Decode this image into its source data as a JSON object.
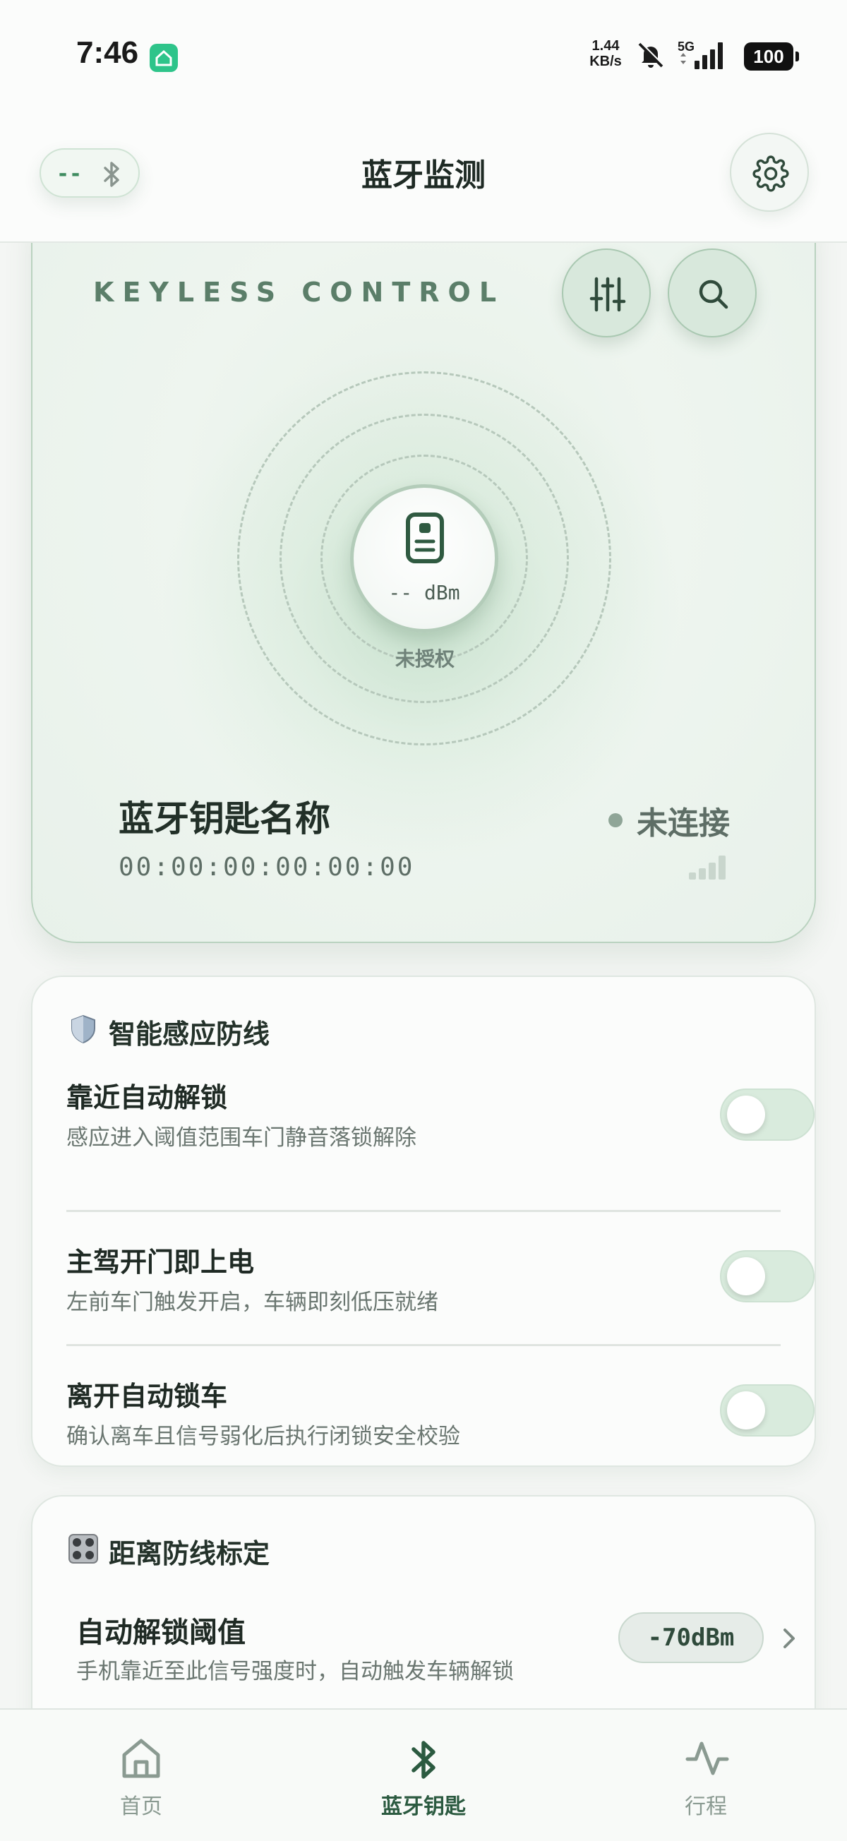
{
  "status_bar": {
    "time": "7:46",
    "net_speed_value": "1.44",
    "net_speed_unit": "KB/s",
    "network": "5G",
    "battery": "100"
  },
  "app_bar": {
    "title": "蓝牙监测",
    "bt_chip_text": "--"
  },
  "hero": {
    "heading": "KEYLESS CONTROL",
    "rssi": "-- dBm",
    "auth_status": "未授权",
    "device_name": "蓝牙钥匙名称",
    "device_mac": "00:00:00:00:00:00",
    "connection_status": "未连接"
  },
  "defense": {
    "title_icon": "🛡️",
    "title": "智能感应防线",
    "items": [
      {
        "title": "靠近自动解锁",
        "desc": "感应进入阈值范围车门静音落锁解除",
        "enabled": false
      },
      {
        "title": "主驾开门即上电",
        "desc": "左前车门触发开启，车辆即刻低压就绪",
        "enabled": false
      },
      {
        "title": "离开自动锁车",
        "desc": "确认离车且信号弱化后执行闭锁安全校验",
        "enabled": false
      }
    ]
  },
  "distance": {
    "title_icon": "🎛️",
    "title": "距离防线标定",
    "threshold_title": "自动解锁阈值",
    "threshold_desc": "手机靠近至此信号强度时，自动触发车辆解锁",
    "threshold_value": "-70dBm"
  },
  "bottom_nav": {
    "items": [
      {
        "label": "首页",
        "icon": "home-icon",
        "active": false
      },
      {
        "label": "蓝牙钥匙",
        "icon": "bluetooth-icon",
        "active": true
      },
      {
        "label": "行程",
        "icon": "activity-icon",
        "active": false
      }
    ]
  },
  "colors": {
    "accent": "#2b5a40",
    "card_green": "#e8f1ea",
    "toggle_off": "#d9ebdd"
  }
}
